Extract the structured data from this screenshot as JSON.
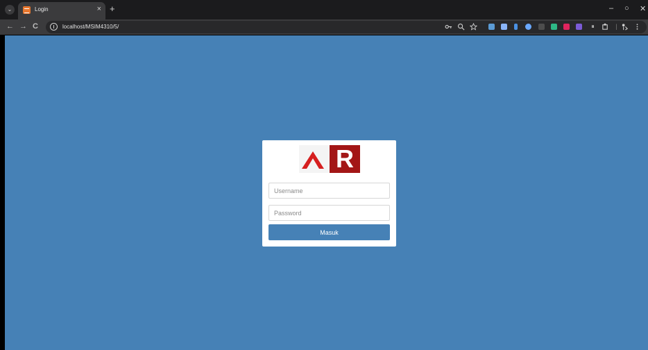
{
  "browser": {
    "tab": {
      "title": "Login",
      "close_glyph": "×"
    },
    "new_tab_glyph": "+",
    "tab_menu_glyph": "⌄",
    "window_controls": {
      "minimize": "–",
      "restore": "○",
      "close": "✕"
    },
    "nav": {
      "back": "←",
      "forward": "→",
      "reload": "C"
    },
    "url": "localhost/MSIM4310/5/",
    "toolbar_icons": [
      "key-icon",
      "zoom-icon",
      "star-icon"
    ],
    "extension_colors": [
      "#5b9bd5",
      "#8ab4f8",
      "#4a90e2",
      "#6aa8ff",
      "#4d4d4d",
      "#2eb886",
      "#e0245e",
      "#7b5bd6"
    ]
  },
  "page": {
    "background": "#4681b6",
    "logo": {
      "letter_r": "R",
      "a_color": "#d61f1f",
      "r_color": "#a31616"
    },
    "form": {
      "username_placeholder": "Username",
      "password_placeholder": "Password",
      "submit_label": "Masuk"
    }
  }
}
